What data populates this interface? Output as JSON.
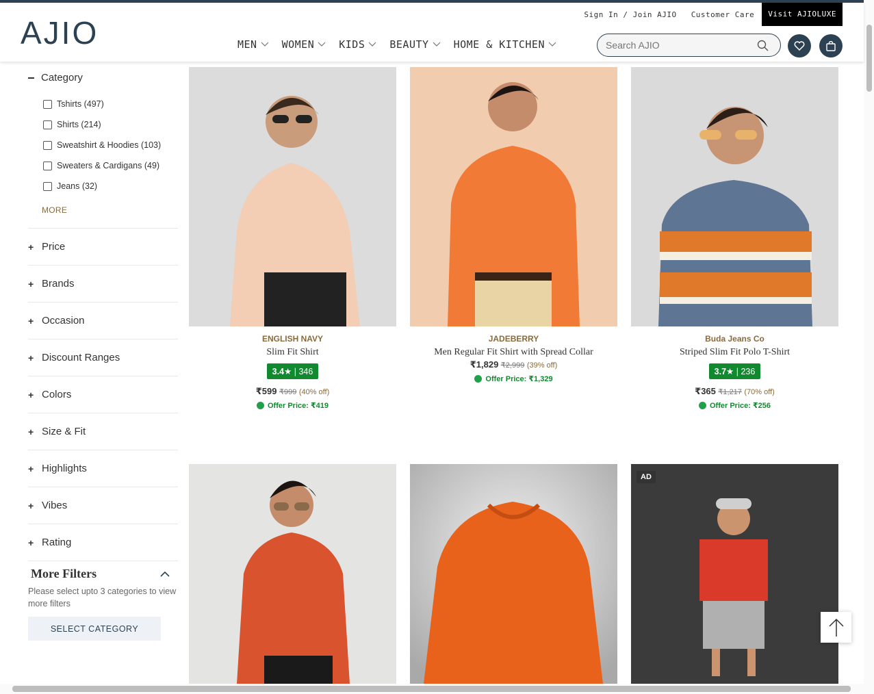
{
  "header": {
    "logo": "AJIO",
    "top_links": {
      "signin": "Sign In / Join AJIO",
      "care": "Customer Care",
      "luxe": "Visit AJIOLUXE"
    },
    "nav": [
      "MEN",
      "WOMEN",
      "KIDS",
      "BEAUTY",
      "HOME & KITCHEN"
    ],
    "search_placeholder": "Search AJIO",
    "icons": {
      "search": "search-icon",
      "wishlist": "heart-icon",
      "bag": "bag-icon"
    }
  },
  "sidebar": {
    "category_title": "Category",
    "categories": [
      "Tshirts (497)",
      "Shirts (214)",
      "Sweatshirt & Hoodies (103)",
      "Sweaters & Cardigans (49)",
      "Jeans (32)"
    ],
    "more": "MORE",
    "filters": [
      "Price",
      "Brands",
      "Occasion",
      "Discount Ranges",
      "Colors",
      "Size & Fit",
      "Highlights",
      "Vibes",
      "Rating"
    ],
    "more_filters": {
      "title": "More Filters",
      "desc": "Please select upto 3 categories to view more filters",
      "button": "SELECT CATEGORY"
    }
  },
  "products": [
    {
      "brand": "ENGLISH NAVY",
      "name": "Slim Fit Shirt",
      "rating": "3.4★",
      "rating_count": "| 346",
      "price": "₹599",
      "mrp": "₹999",
      "discount": "(40% off)",
      "offer": "Offer Price: ₹419",
      "color": "#f3cdb4"
    },
    {
      "brand": "JADEBERRY",
      "name": "Men Regular Fit Shirt with Spread Collar",
      "price": "₹1,829",
      "mrp": "₹2,999",
      "discount": "(39% off)",
      "offer": "Offer Price: ₹1,329",
      "color": "#f07a36"
    },
    {
      "brand": "Buda Jeans Co",
      "name": "Striped Slim Fit Polo T-Shirt",
      "rating": "3.7★",
      "rating_count": "| 236",
      "price": "₹365",
      "mrp": "₹1,217",
      "discount": "(70% off)",
      "offer": "Offer Price: ₹256",
      "color": "#e07a2a"
    },
    {
      "color": "#d9542e"
    },
    {
      "color": "#e8621c"
    },
    {
      "ad": "AD",
      "color": "#d93a2a"
    }
  ]
}
